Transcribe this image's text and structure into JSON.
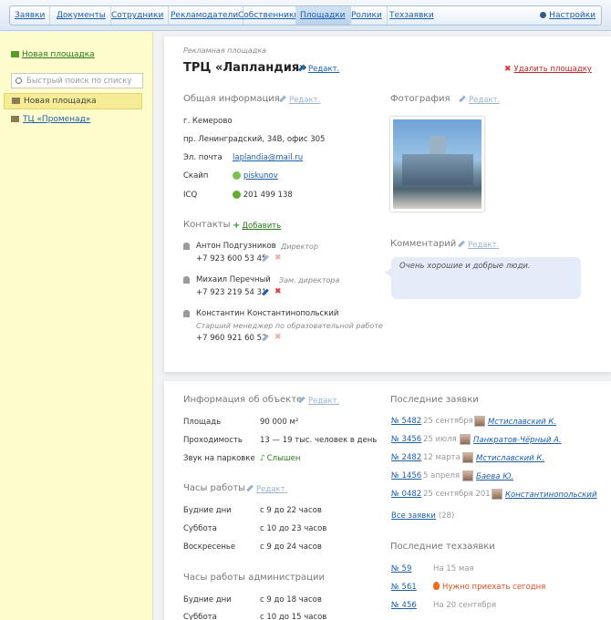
{
  "nav": {
    "items": [
      "Заявки",
      "Документы",
      "Сотрудники",
      "Рекламодатели",
      "Собственники",
      "Площадки",
      "Ролики",
      "Техзаявки"
    ],
    "active_index": 5,
    "settings": "Настройки"
  },
  "sidebar": {
    "new_place": "Новая площадка",
    "search_placeholder": "Быстрый поиск по списку",
    "items": [
      "Новая площадка",
      "ТЦ «Променад»"
    ]
  },
  "header": {
    "kicker": "Рекламная площадка",
    "title": "ТРЦ «Лапландия»",
    "edit": "Редакт.",
    "delete": "Удалить площадку"
  },
  "general": {
    "title": "Общая информация",
    "edit": "Редакт.",
    "city": "г. Кемерово",
    "address": "пр. Ленинградский, 34В, офис 305",
    "email_label": "Эл. почта",
    "email": "laplandia@mail.ru",
    "skype_label": "Скайп",
    "skype": "piskunov",
    "icq_label": "ICQ",
    "icq": "201 499 138"
  },
  "photo": {
    "title": "Фотография",
    "edit": "Редакт."
  },
  "contacts": {
    "title": "Контакты",
    "add": "Добавить",
    "people": [
      {
        "name": "Антон Подгузников",
        "role": "Директор",
        "phone": "+7 923 600 53 45"
      },
      {
        "name": "Михаил Перечный",
        "role": "Зам. директора",
        "phone": "+7 923 219 54 31"
      },
      {
        "name": "Константин Константинопольский",
        "role": "Старший менеджер по образовательной работе",
        "phone": "+7 960 921 60 52"
      }
    ]
  },
  "comment": {
    "title": "Комментарий",
    "edit": "Редакт.",
    "text": "Очень хорошие и добрые люди."
  },
  "object": {
    "title": "Информация об объекте",
    "edit": "Редакт.",
    "rows": [
      {
        "label": "Площадь",
        "value": "90 000 м²"
      },
      {
        "label": "Проходимость",
        "value": "13 — 19 тыс. человек в день"
      },
      {
        "label": "Звук на парковке",
        "value": "Слышен"
      }
    ]
  },
  "hours": {
    "title": "Часы работы",
    "edit": "Редакт.",
    "rows": [
      {
        "label": "Будние дни",
        "value": "с 9 до 22 часов"
      },
      {
        "label": "Суббота",
        "value": "с 10 до 23 часов"
      },
      {
        "label": "Воскресенье",
        "value": "с 9 до 24 часов"
      }
    ]
  },
  "admin_hours": {
    "title": "Часы работы администрации",
    "rows": [
      {
        "label": "Будние дни",
        "value": "с 9 до 18 часов"
      },
      {
        "label": "Суббота",
        "value": "с 10 до 15 часов"
      }
    ]
  },
  "requests": {
    "title": "Последние заявки",
    "items": [
      {
        "num": "№ 5482",
        "date": "25 сентября",
        "user": "Мстиславский К."
      },
      {
        "num": "№ 3456",
        "date": "25 июля",
        "user": "Панкратов-Чёрный А."
      },
      {
        "num": "№ 2482",
        "date": "12 марта",
        "user": "Мстиславский К."
      },
      {
        "num": "№ 1456",
        "date": "5 апреля",
        "user": "Баева Ю."
      },
      {
        "num": "№ 0482",
        "date": "25 сентября 2011",
        "user": "Константинопольский"
      }
    ],
    "all_link": "Все заявки",
    "all_count": "(28)"
  },
  "tech": {
    "title": "Последние техзаявки",
    "items": [
      {
        "num": "№ 59",
        "text": "На 15 мая"
      },
      {
        "num": "№ 561",
        "text": "Нужно приехать сегодня"
      },
      {
        "num": "№ 456",
        "text": "На 20 сентября"
      }
    ]
  }
}
